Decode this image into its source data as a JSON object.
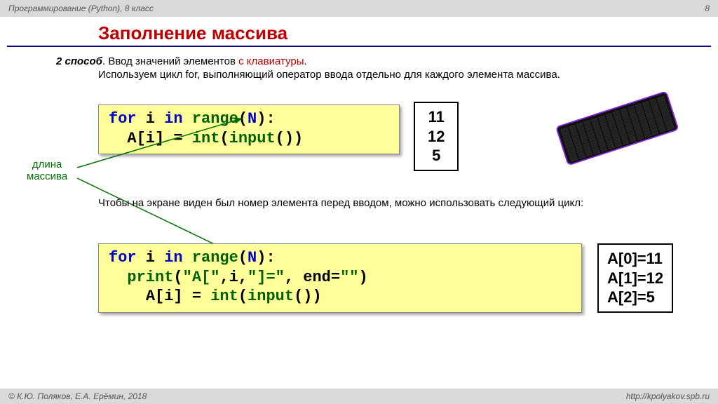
{
  "topbar": {
    "left": "Программирование (Python), 8 класс",
    "right": "8"
  },
  "bottombar": {
    "left": "© К.Ю. Поляков, Е.А. Ерёмин, 2018",
    "right": "http://kpolyakov.spb.ru"
  },
  "title": "Заполнение массива",
  "para1": {
    "prefix": "2 способ",
    "mid": ". Ввод значений элементов ",
    "red": "с клавиатуры",
    "end": "."
  },
  "para2": "Используем цикл for, выполняющий оператор ввода отдельно для каждого элемента массива.",
  "code1": {
    "kw_for": "for",
    "var_i": " i ",
    "kw_in": "in",
    "sp": " ",
    "fn_range": "range",
    "lp": "(",
    "N": "N",
    "rp": ")",
    "colon": ":",
    "line2_indent": "  ",
    "arr": "A[i] = ",
    "fn_int": "int",
    "fn_input": "input",
    "lp2": "(",
    "rp2": "())"
  },
  "output1": {
    "l1": "11",
    "l2": "12",
    "l3": "5"
  },
  "note_len": {
    "l1": "длина",
    "l2": "массива"
  },
  "para3": "Чтобы на экране виден был номер элемента перед вводом, можно использовать следующий цикл:",
  "code2": {
    "kw_for": "for",
    "var_i": " i ",
    "kw_in": "in",
    "sp": " ",
    "fn_range": "range",
    "lp": "(",
    "N": "N",
    "rp": ")",
    "colon": ":",
    "l2_indent": "  ",
    "fn_print": "print",
    "args_a": "(",
    "str1": "\"A[\"",
    "c1": ",i,",
    "str2": "\"]=\"",
    "c2": ", end=",
    "str3": "\"\"",
    "rp2": ")",
    "l3_indent": "    ",
    "arr": "A[i] = ",
    "fn_int": "int",
    "fn_input": "input",
    "rp3": "())"
  },
  "output2": {
    "l1": "A[0]=11",
    "l2": "A[1]=12",
    "l3": "A[2]=5"
  }
}
